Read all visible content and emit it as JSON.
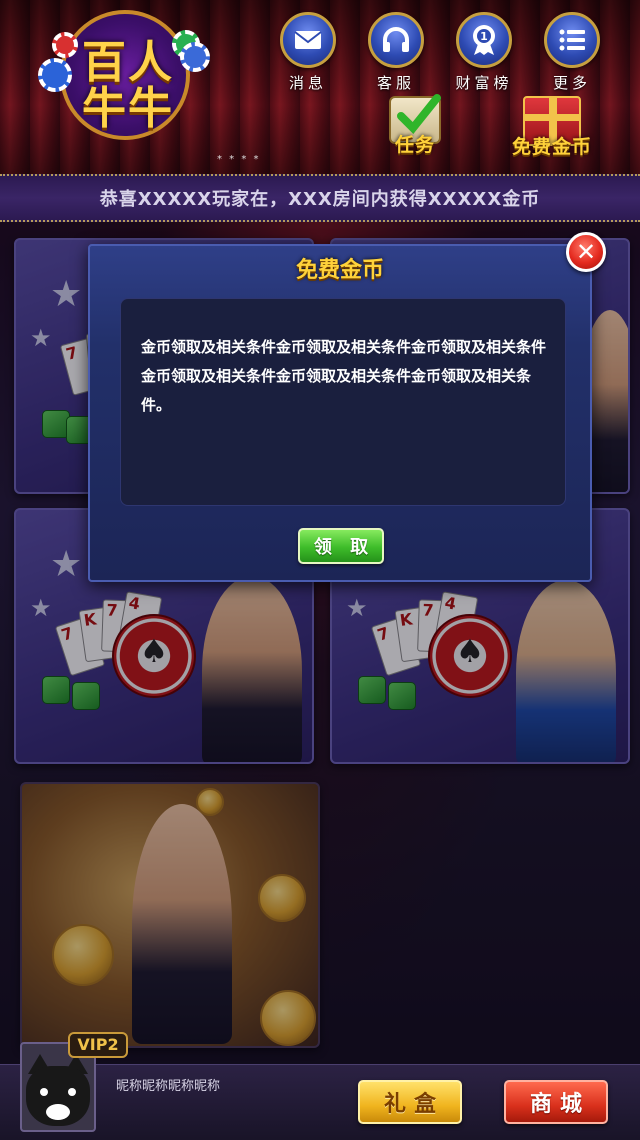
{
  "logo": {
    "line1": "百人",
    "line2": "牛牛"
  },
  "page_indicator": "* * * *",
  "top_nav": [
    {
      "label": "消息",
      "icon": "mail-icon"
    },
    {
      "label": "客服",
      "icon": "headset-icon"
    },
    {
      "label": "财富榜",
      "icon": "medal-icon"
    },
    {
      "label": "更多",
      "icon": "list-icon"
    }
  ],
  "task": {
    "label": "任务",
    "icon": "calendar-check-icon"
  },
  "free_coins": {
    "label": "免费金币",
    "icon": "gift-box-icon"
  },
  "marquee": {
    "text": "恭喜XXXXX玩家在，XXX房间内获得XXXXX金币"
  },
  "modal": {
    "title": "免费金币",
    "body": "金币领取及相关条件金币领取及相关条件金币领取及相关条件金币领取及相关条件金币领取及相关条件金币领取及相关条件。",
    "claim_label": "领 取",
    "close_icon": "close-icon"
  },
  "user": {
    "vip": "VIP2",
    "nickname": "昵称昵称昵称昵称"
  },
  "bottom": {
    "gift_box_label": "礼盒",
    "shop_label": "商城"
  },
  "colors": {
    "gold": "#ffd23a",
    "modal_bg": "#22306a",
    "claim_green": "#3ebc2a",
    "close_red": "#e42a1f",
    "shop_red": "#d9301c",
    "giftbox_yellow": "#f0b41e"
  }
}
